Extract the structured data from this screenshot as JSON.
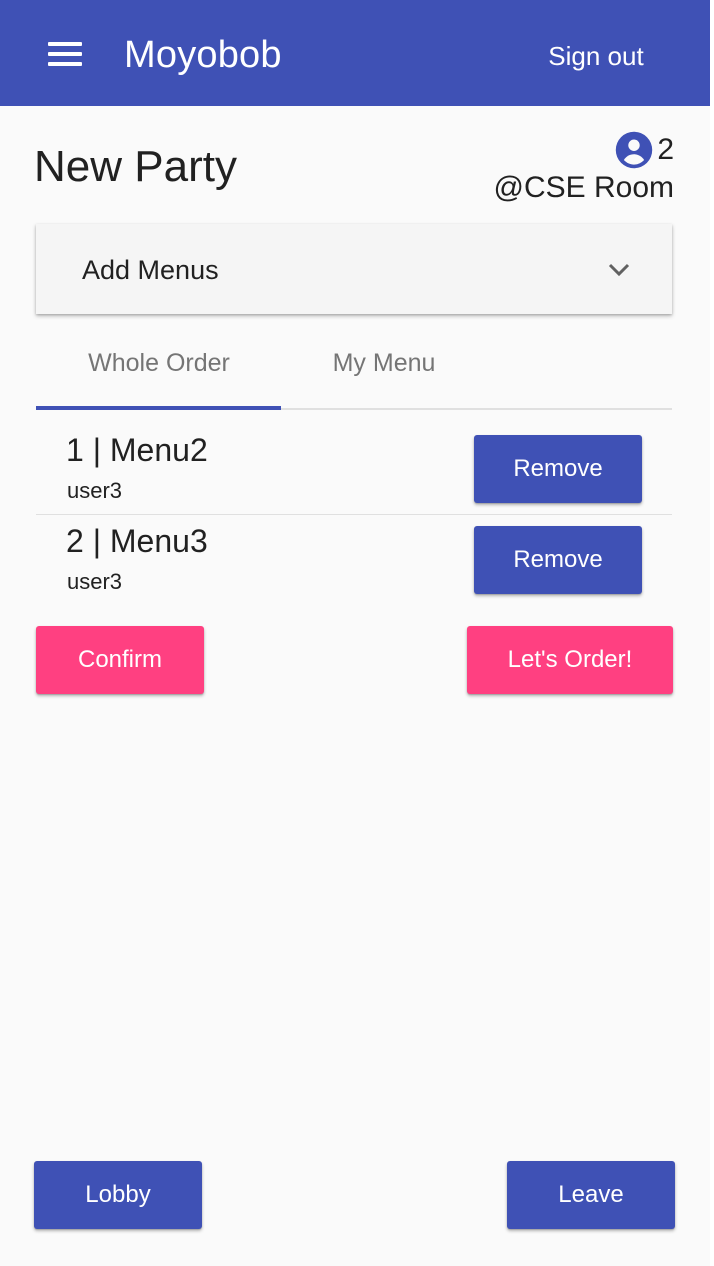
{
  "app_bar": {
    "title": "Moyobob",
    "sign_out_label": "Sign out",
    "color": "#3f51b5"
  },
  "party": {
    "title": "New Party",
    "member_count": "2",
    "location": "@CSE Room"
  },
  "add_menus": {
    "label": "Add Menus"
  },
  "tabs": [
    {
      "label": "Whole Order",
      "selected": true
    },
    {
      "label": "My Menu",
      "selected": false
    }
  ],
  "orders": [
    {
      "title": "1 | Menu2",
      "user": "user3",
      "action_label": "Remove"
    },
    {
      "title": "2 | Menu3",
      "user": "user3",
      "action_label": "Remove"
    }
  ],
  "actions": {
    "confirm_label": "Confirm",
    "order_label": "Let's Order!",
    "accent_color": "#ff4081"
  },
  "footer": {
    "lobby_label": "Lobby",
    "leave_label": "Leave"
  },
  "icons": {
    "menu": "hamburger-menu-icon",
    "members": "account-circle-icon",
    "dropdown": "chevron-down-icon"
  }
}
